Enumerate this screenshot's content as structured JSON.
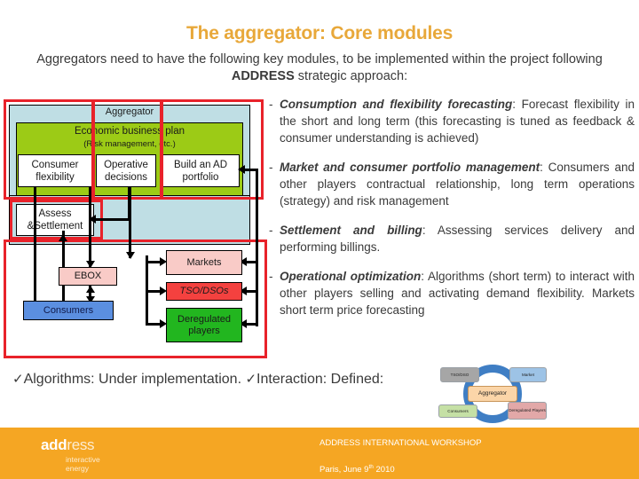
{
  "header": {
    "title": "The aggregator: Core modules",
    "intro_part1": "Aggregators need to have the following key modules, to be implemented within the project following ",
    "intro_strong": "ADDRESS",
    "intro_part2": " strategic approach:"
  },
  "diagram": {
    "aggregator_label": "Aggregator",
    "economic_plan": "Economic business plan",
    "economic_plan_sub": "(Risk management, etc.)",
    "modules": [
      {
        "label": "Consumer flexibility"
      },
      {
        "label": "Operative decisions"
      },
      {
        "label": "Build an AD portfolio"
      },
      {
        "label": "Assess &Settlement"
      }
    ],
    "actors": [
      {
        "label": "Markets",
        "color": "#f9cbc7"
      },
      {
        "label": "TSO/DSOs",
        "color": "#f4413f"
      },
      {
        "label": "Deregulated players",
        "color": "#22b61f"
      },
      {
        "label": "EBOX",
        "color": "#f9cbc7"
      },
      {
        "label": "Consumers",
        "color": "#5b8fe0"
      }
    ],
    "frame_color": "#e8222a",
    "panel_color": "#bfdee4",
    "plan_color": "#9ccb16"
  },
  "bullets": [
    {
      "dash": "-",
      "term": "Consumption and flexibility forecasting",
      "text": ": Forecast flexibility in the short and long term (this forecasting is tuned as feedback & consumer understanding is achieved)"
    },
    {
      "dash": "-",
      "term": "Market and consumer portfolio management",
      "text": ": Consumers and other players contractual relationship, long term operations (strategy) and risk management"
    },
    {
      "dash": "-",
      "term": "Settlement and billing",
      "text": ": Assessing services delivery and performing billings."
    },
    {
      "dash": "-",
      "term": "Operational optimization",
      "text": ": Algorithms (short term) to interact with other players selling and activating demand flexibility. Markets short term price forecasting"
    }
  ],
  "status": {
    "check_icon": "check-icon",
    "algorithms": "Algorithms: Under implementation.",
    "interaction": "Interaction: Defined:"
  },
  "mini_diagram": {
    "center": "Aggregator",
    "nodes": [
      {
        "label": "TSO/DSO",
        "color": "#a6a6a6"
      },
      {
        "label": "Market",
        "color": "#9dc3e6"
      },
      {
        "label": "Consumers",
        "color": "#c5e0a5"
      },
      {
        "label": "Deregulated Players",
        "color": "#e2a8a8"
      }
    ],
    "ring_color": "#3f7ec4"
  },
  "footer": {
    "brand_strong": "add",
    "brand_light": "ress",
    "tagline_line1": "interactive",
    "tagline_line2": "energy",
    "event": "ADDRESS INTERNATIONAL WORKSHOP",
    "date_prefix": "Paris, June 9",
    "date_sup": "th",
    "date_suffix": " 2010",
    "background": "#f5a623"
  }
}
